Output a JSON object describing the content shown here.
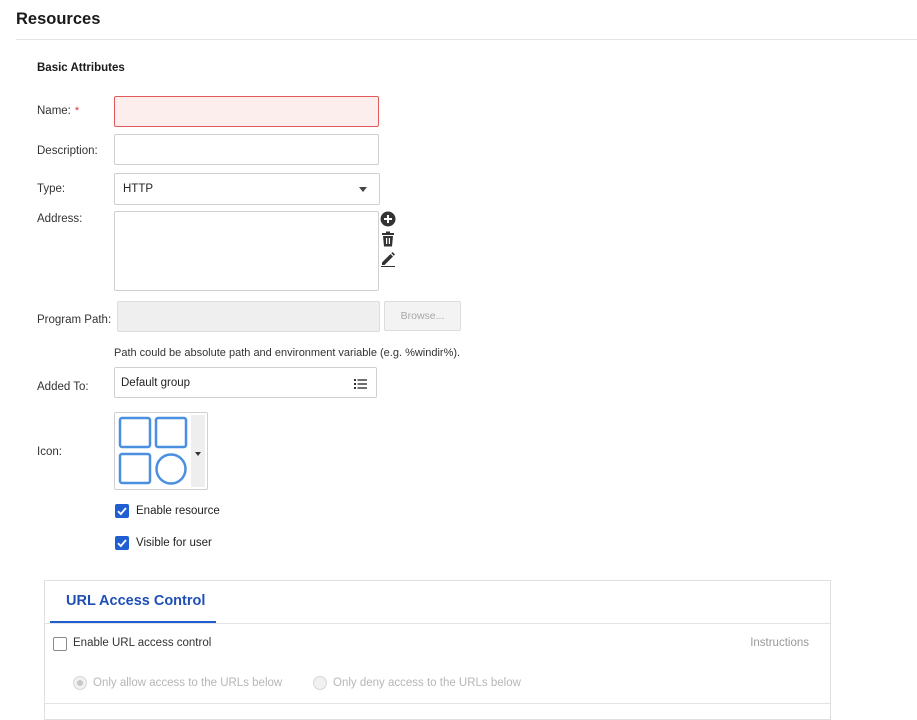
{
  "page": {
    "title": "Resources"
  },
  "basic": {
    "section_title": "Basic Attributes",
    "name_label": "Name:",
    "required_mark": "*",
    "name_value": "",
    "description_label": "Description:",
    "description_value": "",
    "type_label": "Type:",
    "type_value": "HTTP",
    "address_label": "Address:",
    "address_actions": [
      "add-circle-icon",
      "trash-icon",
      "pencil-icon"
    ],
    "program_path_label": "Program Path:",
    "browse_label": "Browse...",
    "path_hint": "Path could be absolute path and environment variable (e.g. %windir%).",
    "added_to_label": "Added To:",
    "added_to_value": "Default group",
    "icon_label": "Icon:",
    "enable_resource_label": "Enable resource",
    "enable_resource_checked": true,
    "visible_user_label": "Visible for user",
    "visible_user_checked": true
  },
  "url_access": {
    "tab_label": "URL Access Control",
    "enable_label": "Enable URL access control",
    "enable_checked": false,
    "instructions_label": "Instructions",
    "allow_label": "Only allow access to the URLs below",
    "deny_label": "Only deny access to the URLs below",
    "selected_mode": "allow"
  },
  "colors": {
    "accent": "#1f5fd1",
    "error_border": "#e05a5a",
    "error_bg": "#fdeeee",
    "icon_blue": "#4a8fe0"
  }
}
